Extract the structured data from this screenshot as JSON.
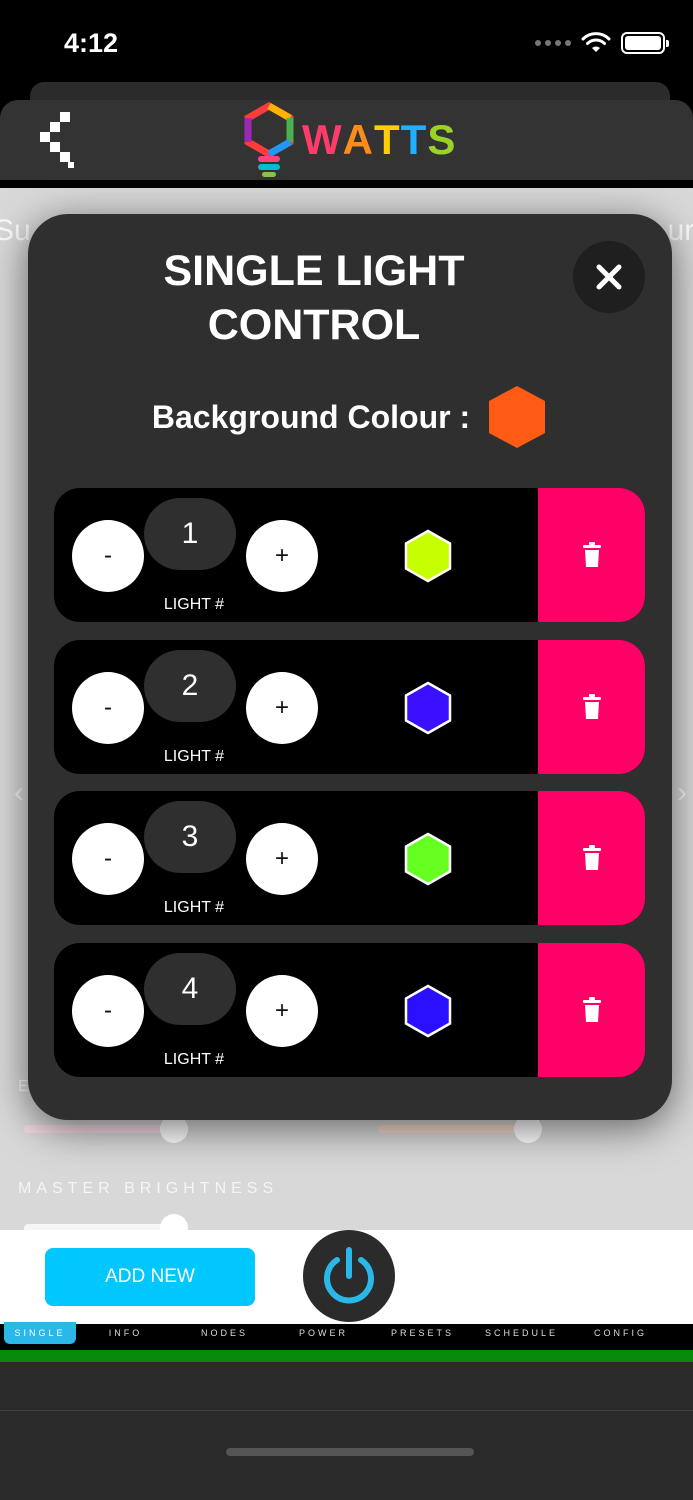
{
  "status": {
    "time": "4:12"
  },
  "header": {
    "logo_text": "WATTS"
  },
  "modal": {
    "title_line1": "SINGLE LIGHT",
    "title_line2": "CONTROL",
    "background_label": "Background Colour :",
    "background_color": "#ff5b14",
    "lights": [
      {
        "number": "1",
        "label": "LIGHT #",
        "color": "#c8ff00"
      },
      {
        "number": "2",
        "label": "LIGHT #",
        "color": "#3a10ff"
      },
      {
        "number": "3",
        "label": "LIGHT #",
        "color": "#66ff22"
      },
      {
        "number": "4",
        "label": "LIGHT #",
        "color": "#2a10ff"
      }
    ],
    "minus_label": "-",
    "plus_label": "+"
  },
  "background_page": {
    "master_brightness_label": "MASTER BRIGHTNESS",
    "left_edge_text": "Su",
    "right_edge_text": "un",
    "partial_letter": "E"
  },
  "actions": {
    "add_new_label": "ADD NEW"
  },
  "tabs": [
    "SINGLE",
    "INFO",
    "NODES",
    "POWER",
    "PRESETS",
    "SCHEDULE",
    "CONFIG"
  ],
  "colors": {
    "accent": "#00c8ff",
    "delete": "#ff0066",
    "power_ring": "#2bb8e8"
  }
}
